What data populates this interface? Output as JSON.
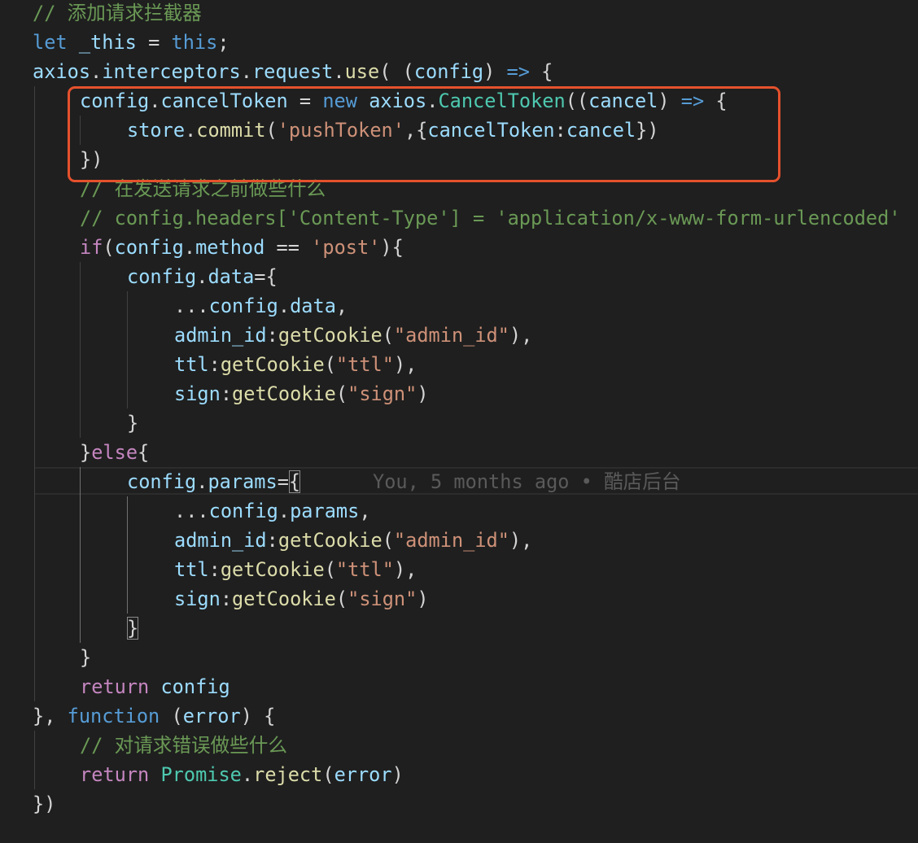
{
  "editor": {
    "highlight_color": "#e5512d",
    "lines": [
      {
        "tokens": [
          {
            "t": "// 添加请求拦截器",
            "c": "comment"
          }
        ]
      },
      {
        "tokens": [
          {
            "t": "let",
            "c": "kw"
          },
          {
            "t": " ",
            "c": "plain"
          },
          {
            "t": "_this",
            "c": "var"
          },
          {
            "t": " = ",
            "c": "plain"
          },
          {
            "t": "this",
            "c": "kw"
          },
          {
            "t": ";",
            "c": "plain"
          }
        ]
      },
      {
        "tokens": [
          {
            "t": "axios",
            "c": "var"
          },
          {
            "t": ".",
            "c": "plain"
          },
          {
            "t": "interceptors",
            "c": "var"
          },
          {
            "t": ".",
            "c": "plain"
          },
          {
            "t": "request",
            "c": "var"
          },
          {
            "t": ".",
            "c": "plain"
          },
          {
            "t": "use",
            "c": "func"
          },
          {
            "t": "( (",
            "c": "plain"
          },
          {
            "t": "config",
            "c": "var"
          },
          {
            "t": ") ",
            "c": "plain"
          },
          {
            "t": "=>",
            "c": "kw"
          },
          {
            "t": " {",
            "c": "plain"
          }
        ]
      },
      {
        "tokens": [
          {
            "t": "config",
            "c": "var"
          },
          {
            "t": ".",
            "c": "plain"
          },
          {
            "t": "cancelToken",
            "c": "var"
          },
          {
            "t": " = ",
            "c": "plain"
          },
          {
            "t": "new",
            "c": "kw"
          },
          {
            "t": " ",
            "c": "plain"
          },
          {
            "t": "axios",
            "c": "var"
          },
          {
            "t": ".",
            "c": "plain"
          },
          {
            "t": "CancelToken",
            "c": "class"
          },
          {
            "t": "((",
            "c": "plain"
          },
          {
            "t": "cancel",
            "c": "var"
          },
          {
            "t": ") ",
            "c": "plain"
          },
          {
            "t": "=>",
            "c": "kw"
          },
          {
            "t": " {",
            "c": "plain"
          }
        ]
      },
      {
        "tokens": [
          {
            "t": "store",
            "c": "var"
          },
          {
            "t": ".",
            "c": "plain"
          },
          {
            "t": "commit",
            "c": "func"
          },
          {
            "t": "(",
            "c": "plain"
          },
          {
            "t": "'pushToken'",
            "c": "str"
          },
          {
            "t": ",{",
            "c": "plain"
          },
          {
            "t": "cancelToken",
            "c": "var"
          },
          {
            "t": ":",
            "c": "plain"
          },
          {
            "t": "cancel",
            "c": "var"
          },
          {
            "t": "})",
            "c": "plain"
          }
        ]
      },
      {
        "tokens": [
          {
            "t": "})",
            "c": "plain"
          }
        ]
      },
      {
        "tokens": [
          {
            "t": "// 在发送请求之前做些什么",
            "c": "comment"
          }
        ]
      },
      {
        "tokens": [
          {
            "t": "// config.headers['Content-Type'] = 'application/x-www-form-urlencoded'",
            "c": "comment"
          }
        ]
      },
      {
        "tokens": [
          {
            "t": "if",
            "c": "ctrl"
          },
          {
            "t": "(",
            "c": "plain"
          },
          {
            "t": "config",
            "c": "var"
          },
          {
            "t": ".",
            "c": "plain"
          },
          {
            "t": "method",
            "c": "var"
          },
          {
            "t": " == ",
            "c": "plain"
          },
          {
            "t": "'post'",
            "c": "str"
          },
          {
            "t": "){",
            "c": "plain"
          }
        ]
      },
      {
        "tokens": [
          {
            "t": "config",
            "c": "var"
          },
          {
            "t": ".",
            "c": "plain"
          },
          {
            "t": "data",
            "c": "var"
          },
          {
            "t": "={",
            "c": "plain"
          }
        ]
      },
      {
        "tokens": [
          {
            "t": "...",
            "c": "plain"
          },
          {
            "t": "config",
            "c": "var"
          },
          {
            "t": ".",
            "c": "plain"
          },
          {
            "t": "data",
            "c": "var"
          },
          {
            "t": ",",
            "c": "plain"
          }
        ]
      },
      {
        "tokens": [
          {
            "t": "admin_id",
            "c": "var"
          },
          {
            "t": ":",
            "c": "plain"
          },
          {
            "t": "getCookie",
            "c": "func"
          },
          {
            "t": "(",
            "c": "plain"
          },
          {
            "t": "\"admin_id\"",
            "c": "str"
          },
          {
            "t": "),",
            "c": "plain"
          }
        ]
      },
      {
        "tokens": [
          {
            "t": "ttl",
            "c": "var"
          },
          {
            "t": ":",
            "c": "plain"
          },
          {
            "t": "getCookie",
            "c": "func"
          },
          {
            "t": "(",
            "c": "plain"
          },
          {
            "t": "\"ttl\"",
            "c": "str"
          },
          {
            "t": "),",
            "c": "plain"
          }
        ]
      },
      {
        "tokens": [
          {
            "t": "sign",
            "c": "var"
          },
          {
            "t": ":",
            "c": "plain"
          },
          {
            "t": "getCookie",
            "c": "func"
          },
          {
            "t": "(",
            "c": "plain"
          },
          {
            "t": "\"sign\"",
            "c": "str"
          },
          {
            "t": ")",
            "c": "plain"
          }
        ]
      },
      {
        "tokens": [
          {
            "t": "}",
            "c": "plain"
          }
        ]
      },
      {
        "tokens": [
          {
            "t": "}",
            "c": "plain"
          },
          {
            "t": "else",
            "c": "ctrl"
          },
          {
            "t": "{",
            "c": "plain"
          }
        ]
      },
      {
        "tokens": [
          {
            "t": "config",
            "c": "var"
          },
          {
            "t": ".",
            "c": "plain"
          },
          {
            "t": "params",
            "c": "var"
          },
          {
            "t": "=",
            "c": "plain"
          },
          {
            "t": "{",
            "c": "plain",
            "m": true
          }
        ]
      },
      {
        "tokens": [
          {
            "t": "...",
            "c": "plain"
          },
          {
            "t": "config",
            "c": "var"
          },
          {
            "t": ".",
            "c": "plain"
          },
          {
            "t": "params",
            "c": "var"
          },
          {
            "t": ",",
            "c": "plain"
          }
        ]
      },
      {
        "tokens": [
          {
            "t": "admin_id",
            "c": "var"
          },
          {
            "t": ":",
            "c": "plain"
          },
          {
            "t": "getCookie",
            "c": "func"
          },
          {
            "t": "(",
            "c": "plain"
          },
          {
            "t": "\"admin_id\"",
            "c": "str"
          },
          {
            "t": "),",
            "c": "plain"
          }
        ]
      },
      {
        "tokens": [
          {
            "t": "ttl",
            "c": "var"
          },
          {
            "t": ":",
            "c": "plain"
          },
          {
            "t": "getCookie",
            "c": "func"
          },
          {
            "t": "(",
            "c": "plain"
          },
          {
            "t": "\"ttl\"",
            "c": "str"
          },
          {
            "t": "),",
            "c": "plain"
          }
        ]
      },
      {
        "tokens": [
          {
            "t": "sign",
            "c": "var"
          },
          {
            "t": ":",
            "c": "plain"
          },
          {
            "t": "getCookie",
            "c": "func"
          },
          {
            "t": "(",
            "c": "plain"
          },
          {
            "t": "\"sign\"",
            "c": "str"
          },
          {
            "t": ")",
            "c": "plain"
          }
        ]
      },
      {
        "tokens": [
          {
            "t": "}",
            "c": "plain",
            "m": true
          }
        ]
      },
      {
        "tokens": [
          {
            "t": "}",
            "c": "plain"
          }
        ]
      },
      {
        "tokens": [
          {
            "t": "return",
            "c": "ctrl"
          },
          {
            "t": " ",
            "c": "plain"
          },
          {
            "t": "config",
            "c": "var"
          }
        ]
      },
      {
        "tokens": [
          {
            "t": "}, ",
            "c": "plain"
          },
          {
            "t": "function",
            "c": "kw"
          },
          {
            "t": " (",
            "c": "plain"
          },
          {
            "t": "error",
            "c": "var"
          },
          {
            "t": ") {",
            "c": "plain"
          }
        ]
      },
      {
        "tokens": [
          {
            "t": "// 对请求错误做些什么",
            "c": "comment"
          }
        ]
      },
      {
        "tokens": [
          {
            "t": "return",
            "c": "ctrl"
          },
          {
            "t": " ",
            "c": "plain"
          },
          {
            "t": "Promise",
            "c": "type"
          },
          {
            "t": ".",
            "c": "plain"
          },
          {
            "t": "reject",
            "c": "func"
          },
          {
            "t": "(",
            "c": "plain"
          },
          {
            "t": "error",
            "c": "var"
          },
          {
            "t": ")",
            "c": "plain"
          }
        ]
      },
      {
        "tokens": [
          {
            "t": "})",
            "c": "plain"
          }
        ]
      }
    ],
    "blame": "You, 5 months ago • 酷店后台"
  }
}
